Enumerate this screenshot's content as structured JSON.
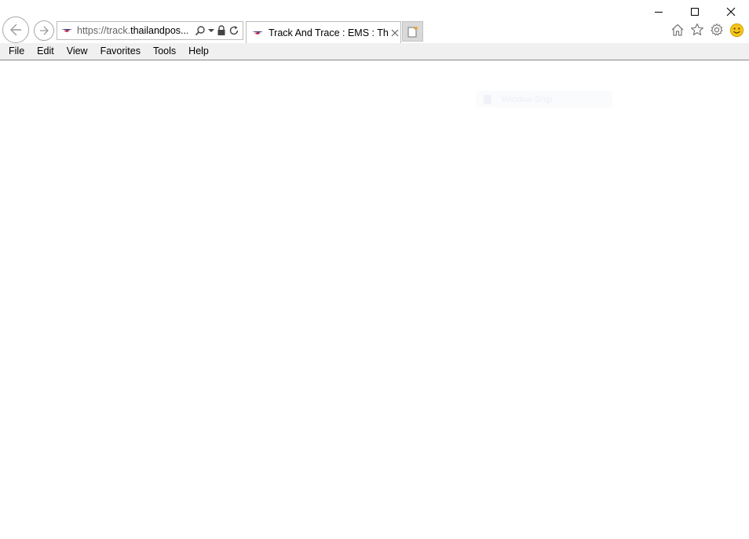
{
  "address": {
    "url_prefix": "https://track.",
    "url_domain": "thailandpos...",
    "icons": [
      "search-icon",
      "dropdown-icon",
      "lock-icon",
      "refresh-icon"
    ]
  },
  "tabs": [
    {
      "title": "Track And Trace : EMS : Thai...",
      "active": true
    }
  ],
  "menu": {
    "items": [
      "File",
      "Edit",
      "View",
      "Favorites",
      "Tools",
      "Help"
    ]
  },
  "toolbar": {
    "icons": [
      "home-icon",
      "favorites-star-icon",
      "settings-gear-icon",
      "feedback-smiley-icon"
    ]
  },
  "overlay": {
    "text": "Window Snip"
  },
  "colors": {
    "menu_bar_bg": "#f0f0f0",
    "favicon_purple": "#4b2a7b",
    "favicon_red": "#c8102e",
    "smiley_yellow": "#f5c518",
    "new_tab_star": "#f0a020"
  }
}
